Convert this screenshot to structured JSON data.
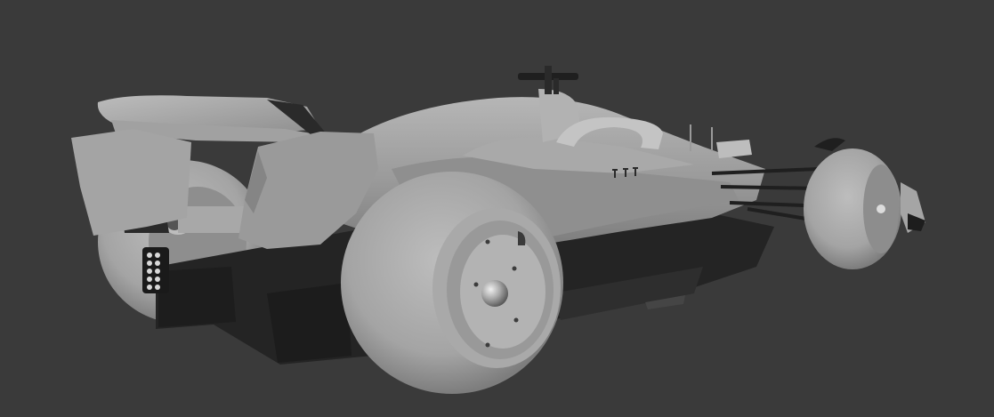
{
  "scene": {
    "subject": "",
    "car_number": "",
    "colors": {
      "background": "#3a3a3a",
      "body": "#9c9c9c",
      "body_light": "#b8b8b8",
      "body_dark": "#7a7a7a",
      "floor": "#242424",
      "tyre": "#a6a6a6",
      "tyre_dark": "#8c8c8c"
    }
  }
}
